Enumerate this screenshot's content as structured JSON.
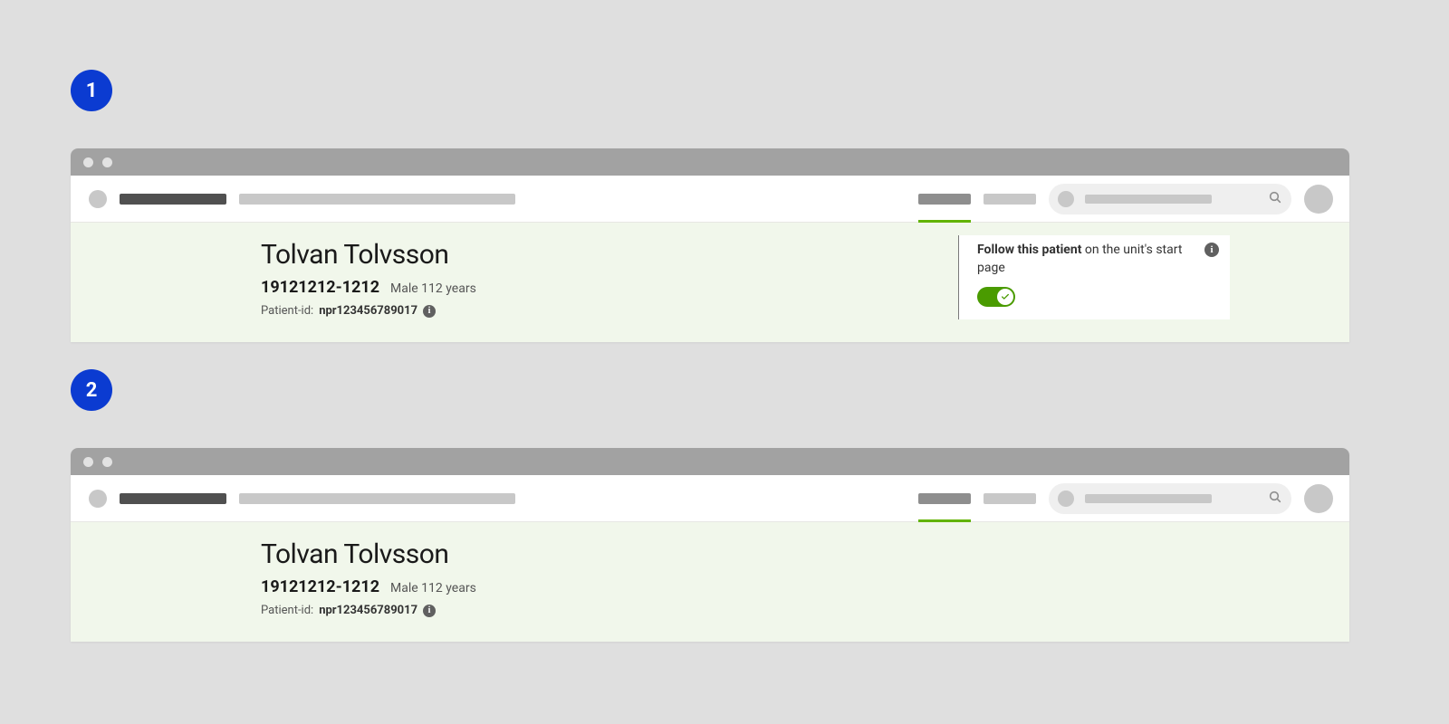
{
  "annotations": {
    "one": "1",
    "two": "2"
  },
  "patient": {
    "name": "Tolvan Tolvsson",
    "pnr": "19121212-1212",
    "meta": "Male 112 years",
    "pid_label": "Patient-id:",
    "pid_value": "npr123456789017"
  },
  "follow": {
    "bold": "Follow this patient",
    "rest": " on the unit's start page",
    "on": true
  },
  "colors": {
    "accent": "#62b300",
    "toggle": "#4a9b00",
    "badge": "#0b3bd1"
  }
}
